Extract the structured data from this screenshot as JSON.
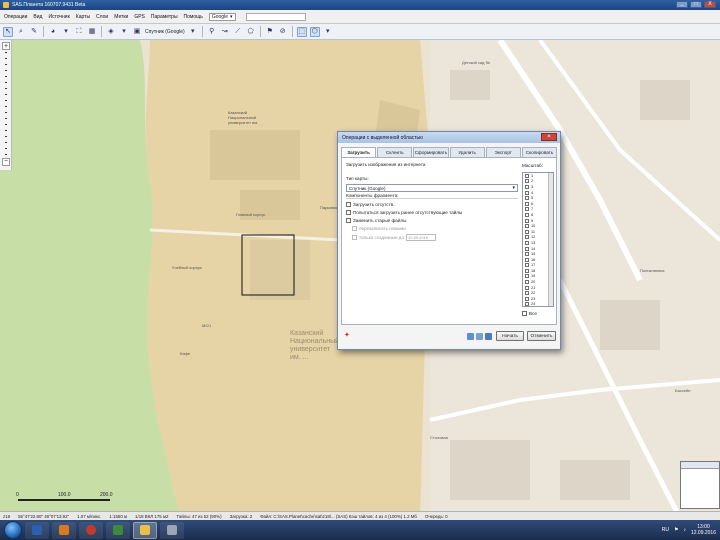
{
  "window": {
    "title": "SAS.Планета 160707.9431 Beta",
    "buttons": [
      "_",
      "□",
      "X"
    ]
  },
  "menubar": {
    "items": [
      "Операции",
      "Вид",
      "Источник",
      "Карты",
      "Слои",
      "Метки",
      "GPS",
      "Параметры",
      "Помощь"
    ],
    "engine_value": "Google",
    "search_placeholder": ""
  },
  "toolbar": {
    "map_type_label": "Спутник (Google)"
  },
  "map": {
    "labels": {
      "label_1": "Казанский Национальный\nуниверситет им.",
      "label_2": "Казанский\nНациональный\nуниверситет\nим. ...",
      "label_3": "Главный корпус",
      "label_4": "МСЧ",
      "label_5": "Учебный корпус",
      "label_6": "Кафе",
      "label_7": "Детский сад №",
      "label_8": "Парковая ул.",
      "label_9": "Поликлиника",
      "label_10": "Столовая",
      "label_11": "Бассейн"
    },
    "scale": {
      "start": "0",
      "mid": "100.0",
      "end": "200.0"
    }
  },
  "statusbar": {
    "items": [
      "z18",
      "55°47'22.80\" 49°07'13.92\"",
      "1.07 м/пикс.",
      "1:1550 м",
      "1/18 ВКЛ 175 м2",
      "Тайлы: 47 из 52 (90%)",
      "Загрузка: 2",
      "Файл: C:\\SAS.Planet\\cache\\sat\\z18\\... (SAS) Кэш тайлов: 4 из 4 (100%) 1.2 Мб",
      "Очередь: 0"
    ]
  },
  "dialog": {
    "title": "Операции с выделенной областью",
    "tabs": [
      "Загрузить",
      "Склеить",
      "Сформировать",
      "Удалить",
      "Экспорт",
      "Скопировать"
    ],
    "active_tab": "Загрузить",
    "heading": "Загрузить изображения из интернета",
    "source_label": "Тип карты:",
    "source_value": "Спутник (Google)",
    "zoom_label": "Масштаб:",
    "options_label": "Компоненты фрагмента:",
    "checkboxes": {
      "check_1": "Загрузить отсутств.",
      "check_2": "Попытаться загрузить ранее отсутствующие тайлы",
      "check_3": "Заменить старые файлы",
      "check_4": "перезаписать новыми",
      "check_5": "только созданные до"
    },
    "date_value": "12.09.2016",
    "levels": [
      "1",
      "2",
      "3",
      "4",
      "5",
      "6",
      "7",
      "8",
      "9",
      "10",
      "11",
      "12",
      "13",
      "14",
      "15",
      "16",
      "17",
      "18",
      "19",
      "20",
      "21",
      "22",
      "23",
      "24"
    ],
    "all_label": "Все",
    "start_button": "Начать",
    "cancel_button": "Отменить"
  },
  "taskbar": {
    "lang": "RU",
    "time": "13:00",
    "date": "12.09.2016"
  },
  "colors": {
    "map_bg": "#ebe3d2",
    "green_area": "#c7dfa6",
    "campus": "#e6d3a6",
    "title_blue": "#2f5fa3"
  }
}
